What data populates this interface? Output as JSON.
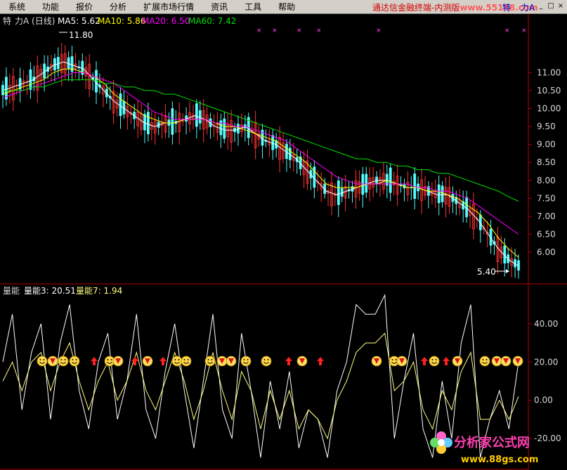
{
  "menu": {
    "items": [
      "系统",
      "功能",
      "报价",
      "分析",
      "扩展市场行情",
      "资讯",
      "工具",
      "帮助"
    ],
    "brand": "通达信金融终端-内测版",
    "brand_site": "www.55188.com",
    "right_items": [
      "特",
      "力A"
    ]
  },
  "price_panel": {
    "mode_label": "特",
    "title": "力A (日线)",
    "ma5_label": "MA5: 5.62",
    "ma10_label": "MA10: 5.86",
    "ma20_label": "MA20: 6.50",
    "ma60_label": "MA60: 7.42",
    "high_marker": "11.80",
    "low_marker": "5.40",
    "colors": {
      "up": "#ff3232",
      "down": "#54fcfc",
      "ma5": "#ffffff",
      "ma10": "#ffff00",
      "ma20": "#ff00ff",
      "ma60": "#00e000",
      "axis": "#b00000"
    },
    "y_ticks": [
      "11.00",
      "10.50",
      "10.00",
      "9.50",
      "9.00",
      "8.50",
      "8.00",
      "7.50",
      "7.00",
      "6.50",
      "6.00"
    ]
  },
  "volume_panel": {
    "title": "量能",
    "line3_label": "量能3: 20.51",
    "line7_label": "量能7: 1.94",
    "colors": {
      "line3": "#ffffff",
      "line7": "#ffff80"
    },
    "y_ticks": [
      "40.00",
      "20.00",
      "0.00",
      "-20.00"
    ]
  },
  "watermark": {
    "main": "分析家公式网",
    "site": "www.88gs.com"
  },
  "chart_data": [
    {
      "type": "candlestick",
      "title": "力A (日线)",
      "ylim": [
        5.2,
        12.2
      ],
      "ohlc_note": "daily candles, high 11.80, low 5.40",
      "series": [
        {
          "name": "MA5",
          "values": [
            10.5,
            10.6,
            10.7,
            10.8,
            11.0,
            11.2,
            11.3,
            11.2,
            11.1,
            10.8,
            10.5,
            10.2,
            10.0,
            9.8,
            9.6,
            9.5,
            9.6,
            9.6,
            9.7,
            9.8,
            9.7,
            9.5,
            9.4,
            9.4,
            9.5,
            9.3,
            9.1,
            9.0,
            8.8,
            8.6,
            8.3,
            8.0,
            7.7,
            7.6,
            7.7,
            7.8,
            7.9,
            8.0,
            8.0,
            7.9,
            7.8,
            7.8,
            7.7,
            7.6,
            7.6,
            7.4,
            7.2,
            6.9,
            6.5,
            6.1,
            5.8,
            5.62
          ]
        },
        {
          "name": "MA10",
          "values": [
            10.4,
            10.5,
            10.6,
            10.7,
            10.8,
            11.0,
            11.1,
            11.1,
            11.0,
            10.9,
            10.7,
            10.4,
            10.2,
            10.0,
            9.8,
            9.7,
            9.6,
            9.6,
            9.7,
            9.7,
            9.7,
            9.6,
            9.5,
            9.5,
            9.4,
            9.3,
            9.2,
            9.1,
            8.9,
            8.7,
            8.5,
            8.2,
            7.9,
            7.8,
            7.8,
            7.8,
            7.9,
            7.9,
            8.0,
            7.9,
            7.8,
            7.8,
            7.7,
            7.7,
            7.6,
            7.5,
            7.3,
            7.1,
            6.8,
            6.4,
            6.1,
            5.86
          ]
        },
        {
          "name": "MA20",
          "values": [
            10.3,
            10.4,
            10.5,
            10.6,
            10.7,
            10.8,
            10.9,
            11.0,
            11.0,
            10.9,
            10.8,
            10.7,
            10.5,
            10.3,
            10.1,
            9.9,
            9.8,
            9.7,
            9.7,
            9.7,
            9.7,
            9.6,
            9.6,
            9.5,
            9.5,
            9.4,
            9.3,
            9.2,
            9.1,
            8.9,
            8.7,
            8.5,
            8.3,
            8.1,
            8.0,
            7.9,
            7.9,
            7.9,
            7.9,
            7.9,
            7.9,
            7.8,
            7.8,
            7.7,
            7.7,
            7.6,
            7.5,
            7.3,
            7.1,
            6.9,
            6.7,
            6.5
          ]
        },
        {
          "name": "MA60",
          "values": [
            10.5,
            10.5,
            10.5,
            10.6,
            10.6,
            10.7,
            10.8,
            10.8,
            10.8,
            10.8,
            10.7,
            10.7,
            10.6,
            10.6,
            10.5,
            10.5,
            10.4,
            10.4,
            10.3,
            10.2,
            10.1,
            10.0,
            9.9,
            9.8,
            9.7,
            9.6,
            9.5,
            9.4,
            9.3,
            9.2,
            9.1,
            9.0,
            8.9,
            8.8,
            8.7,
            8.6,
            8.6,
            8.5,
            8.5,
            8.4,
            8.4,
            8.3,
            8.3,
            8.2,
            8.2,
            8.1,
            8.0,
            7.9,
            7.8,
            7.7,
            7.55,
            7.42
          ]
        }
      ]
    },
    {
      "type": "line",
      "title": "量能",
      "ylim": [
        -35,
        55
      ],
      "series": [
        {
          "name": "量能3",
          "values": [
            20,
            45,
            -5,
            25,
            40,
            -10,
            30,
            50,
            5,
            -15,
            20,
            35,
            -10,
            10,
            45,
            -5,
            -20,
            15,
            40,
            5,
            -25,
            10,
            45,
            -5,
            -20,
            35,
            5,
            -30,
            10,
            -15,
            15,
            -25,
            -5,
            -10,
            -30,
            5,
            20,
            50,
            45,
            45,
            55,
            -20,
            10,
            35,
            -15,
            -30,
            10,
            -20,
            30,
            50,
            -30,
            -10,
            5,
            -15,
            20
          ]
        },
        {
          "name": "量能7",
          "values": [
            10,
            20,
            5,
            20,
            25,
            5,
            20,
            30,
            10,
            -5,
            10,
            20,
            0,
            10,
            25,
            5,
            -5,
            10,
            25,
            10,
            -10,
            5,
            25,
            5,
            -10,
            15,
            5,
            -15,
            5,
            -10,
            5,
            -15,
            -5,
            -10,
            -20,
            0,
            10,
            25,
            30,
            30,
            35,
            5,
            10,
            20,
            -5,
            -15,
            5,
            -5,
            15,
            25,
            -10,
            -10,
            0,
            -10,
            1.94
          ]
        }
      ]
    }
  ]
}
